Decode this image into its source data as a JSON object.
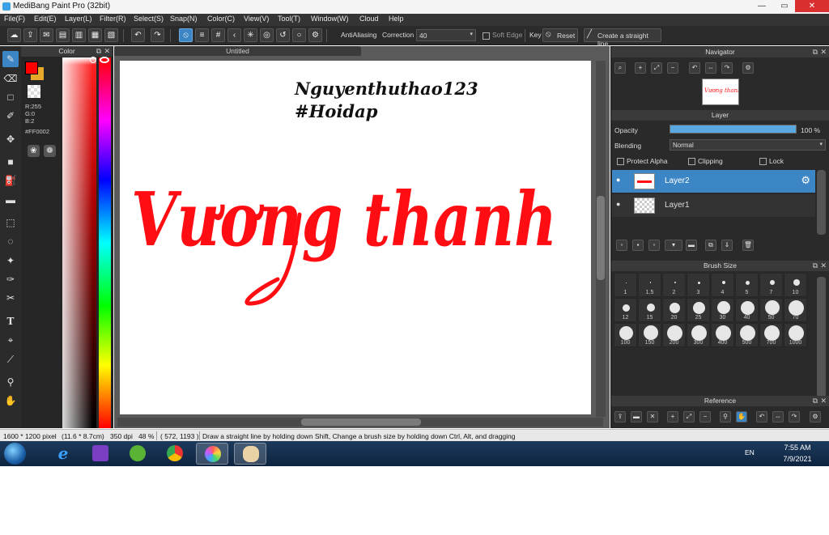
{
  "window": {
    "title": "MediBang Paint Pro (32bit)",
    "minimize": "—",
    "maximize": "▭",
    "close": "✕"
  },
  "menu": [
    "File(F)",
    "Edit(E)",
    "Layer(L)",
    "Filter(R)",
    "Select(S)",
    "Snap(N)",
    "Color(C)",
    "View(V)",
    "Tool(T)",
    "Window(W)",
    "Cloud",
    "Help"
  ],
  "toolbar": {
    "antialiasing": "AntiAliasing",
    "correction_label": "Correction",
    "correction_value": "40",
    "soft_edge": "Soft Edge",
    "key": "Key",
    "reset": "Reset",
    "straight_line": "Create a straight line"
  },
  "color_panel": {
    "title": "Color",
    "rgb": [
      "R:255",
      "G:0",
      "B:2"
    ],
    "hex": "#FF0002",
    "foreground": "#ff0002",
    "background": "#e8a92a"
  },
  "document": {
    "tab": "Untitled",
    "text_small_1": "Nguyenthuthao123",
    "text_small_2": "#Hoidap",
    "text_big": "Vương thanh",
    "ink_color": "#ff0d12"
  },
  "navigator": {
    "title": "Navigator",
    "thumb_text": "Vương thanh"
  },
  "layer": {
    "title": "Layer",
    "opacity_label": "Opacity",
    "opacity_value": "100 %",
    "opacity_fraction": 1.0,
    "blending_label": "Blending",
    "blending_value": "Normal",
    "protect_alpha": "Protect Alpha",
    "clipping": "Clipping",
    "lock": "Lock",
    "layers": [
      {
        "name": "Layer2",
        "selected": true
      },
      {
        "name": "Layer1",
        "selected": false
      }
    ]
  },
  "brush_size": {
    "title": "Brush Size",
    "sizes": [
      "1",
      "1.5",
      "2",
      "3",
      "4",
      "5",
      "7",
      "10",
      "12",
      "15",
      "20",
      "25",
      "30",
      "40",
      "50",
      "70",
      "100",
      "150",
      "200",
      "300",
      "400",
      "500",
      "700",
      "1000"
    ]
  },
  "reference": {
    "title": "Reference"
  },
  "status": {
    "pixels": "1600 * 1200 pixel",
    "cm": "(11.6 * 8.7cm)",
    "dpi": "350 dpi",
    "zoom": "48 %",
    "coords": "( 572, 1193 )",
    "hint": "Draw a straight line by holding down Shift, Change a brush size by holding down Ctrl, Alt, and dragging"
  },
  "taskbar": {
    "lang": "EN",
    "time": "7:55 AM",
    "date": "7/9/2021"
  },
  "accent": "#3d86c6"
}
